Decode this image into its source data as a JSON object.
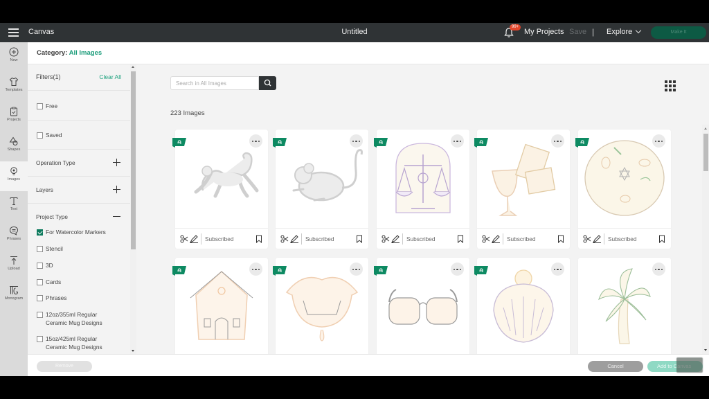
{
  "topbar": {
    "app_name": "Canvas",
    "doc_title": "Untitled",
    "notification_badge": "99+",
    "my_projects": "My Projects",
    "save": "Save",
    "separator": "|",
    "explore": "Explore",
    "make_it": "Make It"
  },
  "leftnav": {
    "items": [
      {
        "label": "New",
        "icon": "plus-circle-icon"
      },
      {
        "label": "Templates",
        "icon": "tshirt-icon"
      },
      {
        "label": "Projects",
        "icon": "clipboard-icon"
      },
      {
        "label": "Shapes",
        "icon": "shapes-icon"
      },
      {
        "label": "Images",
        "icon": "lightbulb-icon",
        "active": true
      },
      {
        "label": "Text",
        "icon": "text-icon"
      },
      {
        "label": "Phrases",
        "icon": "speech-bubble-icon"
      },
      {
        "label": "Upload",
        "icon": "upload-icon"
      },
      {
        "label": "Monogram",
        "icon": "monogram-icon"
      }
    ]
  },
  "category": {
    "label": "Category:",
    "value": "All Images"
  },
  "filters": {
    "title": "Filters(1)",
    "clear_all": "Clear All",
    "quick": [
      {
        "label": "Free",
        "checked": false
      },
      {
        "label": "Saved",
        "checked": false
      }
    ],
    "sections": [
      {
        "label": "Operation Type",
        "expanded": false
      },
      {
        "label": "Layers",
        "expanded": false
      },
      {
        "label": "Project Type",
        "expanded": true
      }
    ],
    "project_types": [
      {
        "label": "For Watercolor Markers",
        "checked": true
      },
      {
        "label": "Stencil",
        "checked": false
      },
      {
        "label": "3D",
        "checked": false
      },
      {
        "label": "Cards",
        "checked": false
      },
      {
        "label": "Phrases",
        "checked": false
      },
      {
        "label": "12oz/355ml Regular Ceramic Mug Designs",
        "checked": false
      },
      {
        "label": "15oz/425ml Regular Ceramic Mug Designs",
        "checked": false
      }
    ]
  },
  "search": {
    "placeholder": "Search in All Images",
    "value": ""
  },
  "results": {
    "count_label": "223 Images"
  },
  "cards": [
    {
      "subject": "monkey",
      "status": "Subscribed",
      "flagged": true
    },
    {
      "subject": "mouse",
      "status": "Subscribed",
      "flagged": true
    },
    {
      "subject": "scales-of-justice",
      "status": "Subscribed",
      "flagged": true
    },
    {
      "subject": "goblet-and-matzah",
      "status": "Subscribed",
      "flagged": true
    },
    {
      "subject": "seder-plate",
      "status": "Subscribed",
      "flagged": true
    },
    {
      "subject": "gingerbread-house",
      "status": "",
      "flagged": true
    },
    {
      "subject": "vampire-lips",
      "status": "",
      "flagged": true
    },
    {
      "subject": "sunglasses",
      "status": "",
      "flagged": true
    },
    {
      "subject": "seashell",
      "status": "",
      "flagged": true
    },
    {
      "subject": "palm-tree",
      "status": "",
      "flagged": false
    }
  ],
  "footer": {
    "remove": "Remove",
    "cancel": "Cancel",
    "add": "Add to Canvas"
  },
  "colors": {
    "brand_green": "#0d7a5d",
    "link_green": "#1a9c7a",
    "topbar": "#2f3335",
    "badge": "#e2452a"
  }
}
